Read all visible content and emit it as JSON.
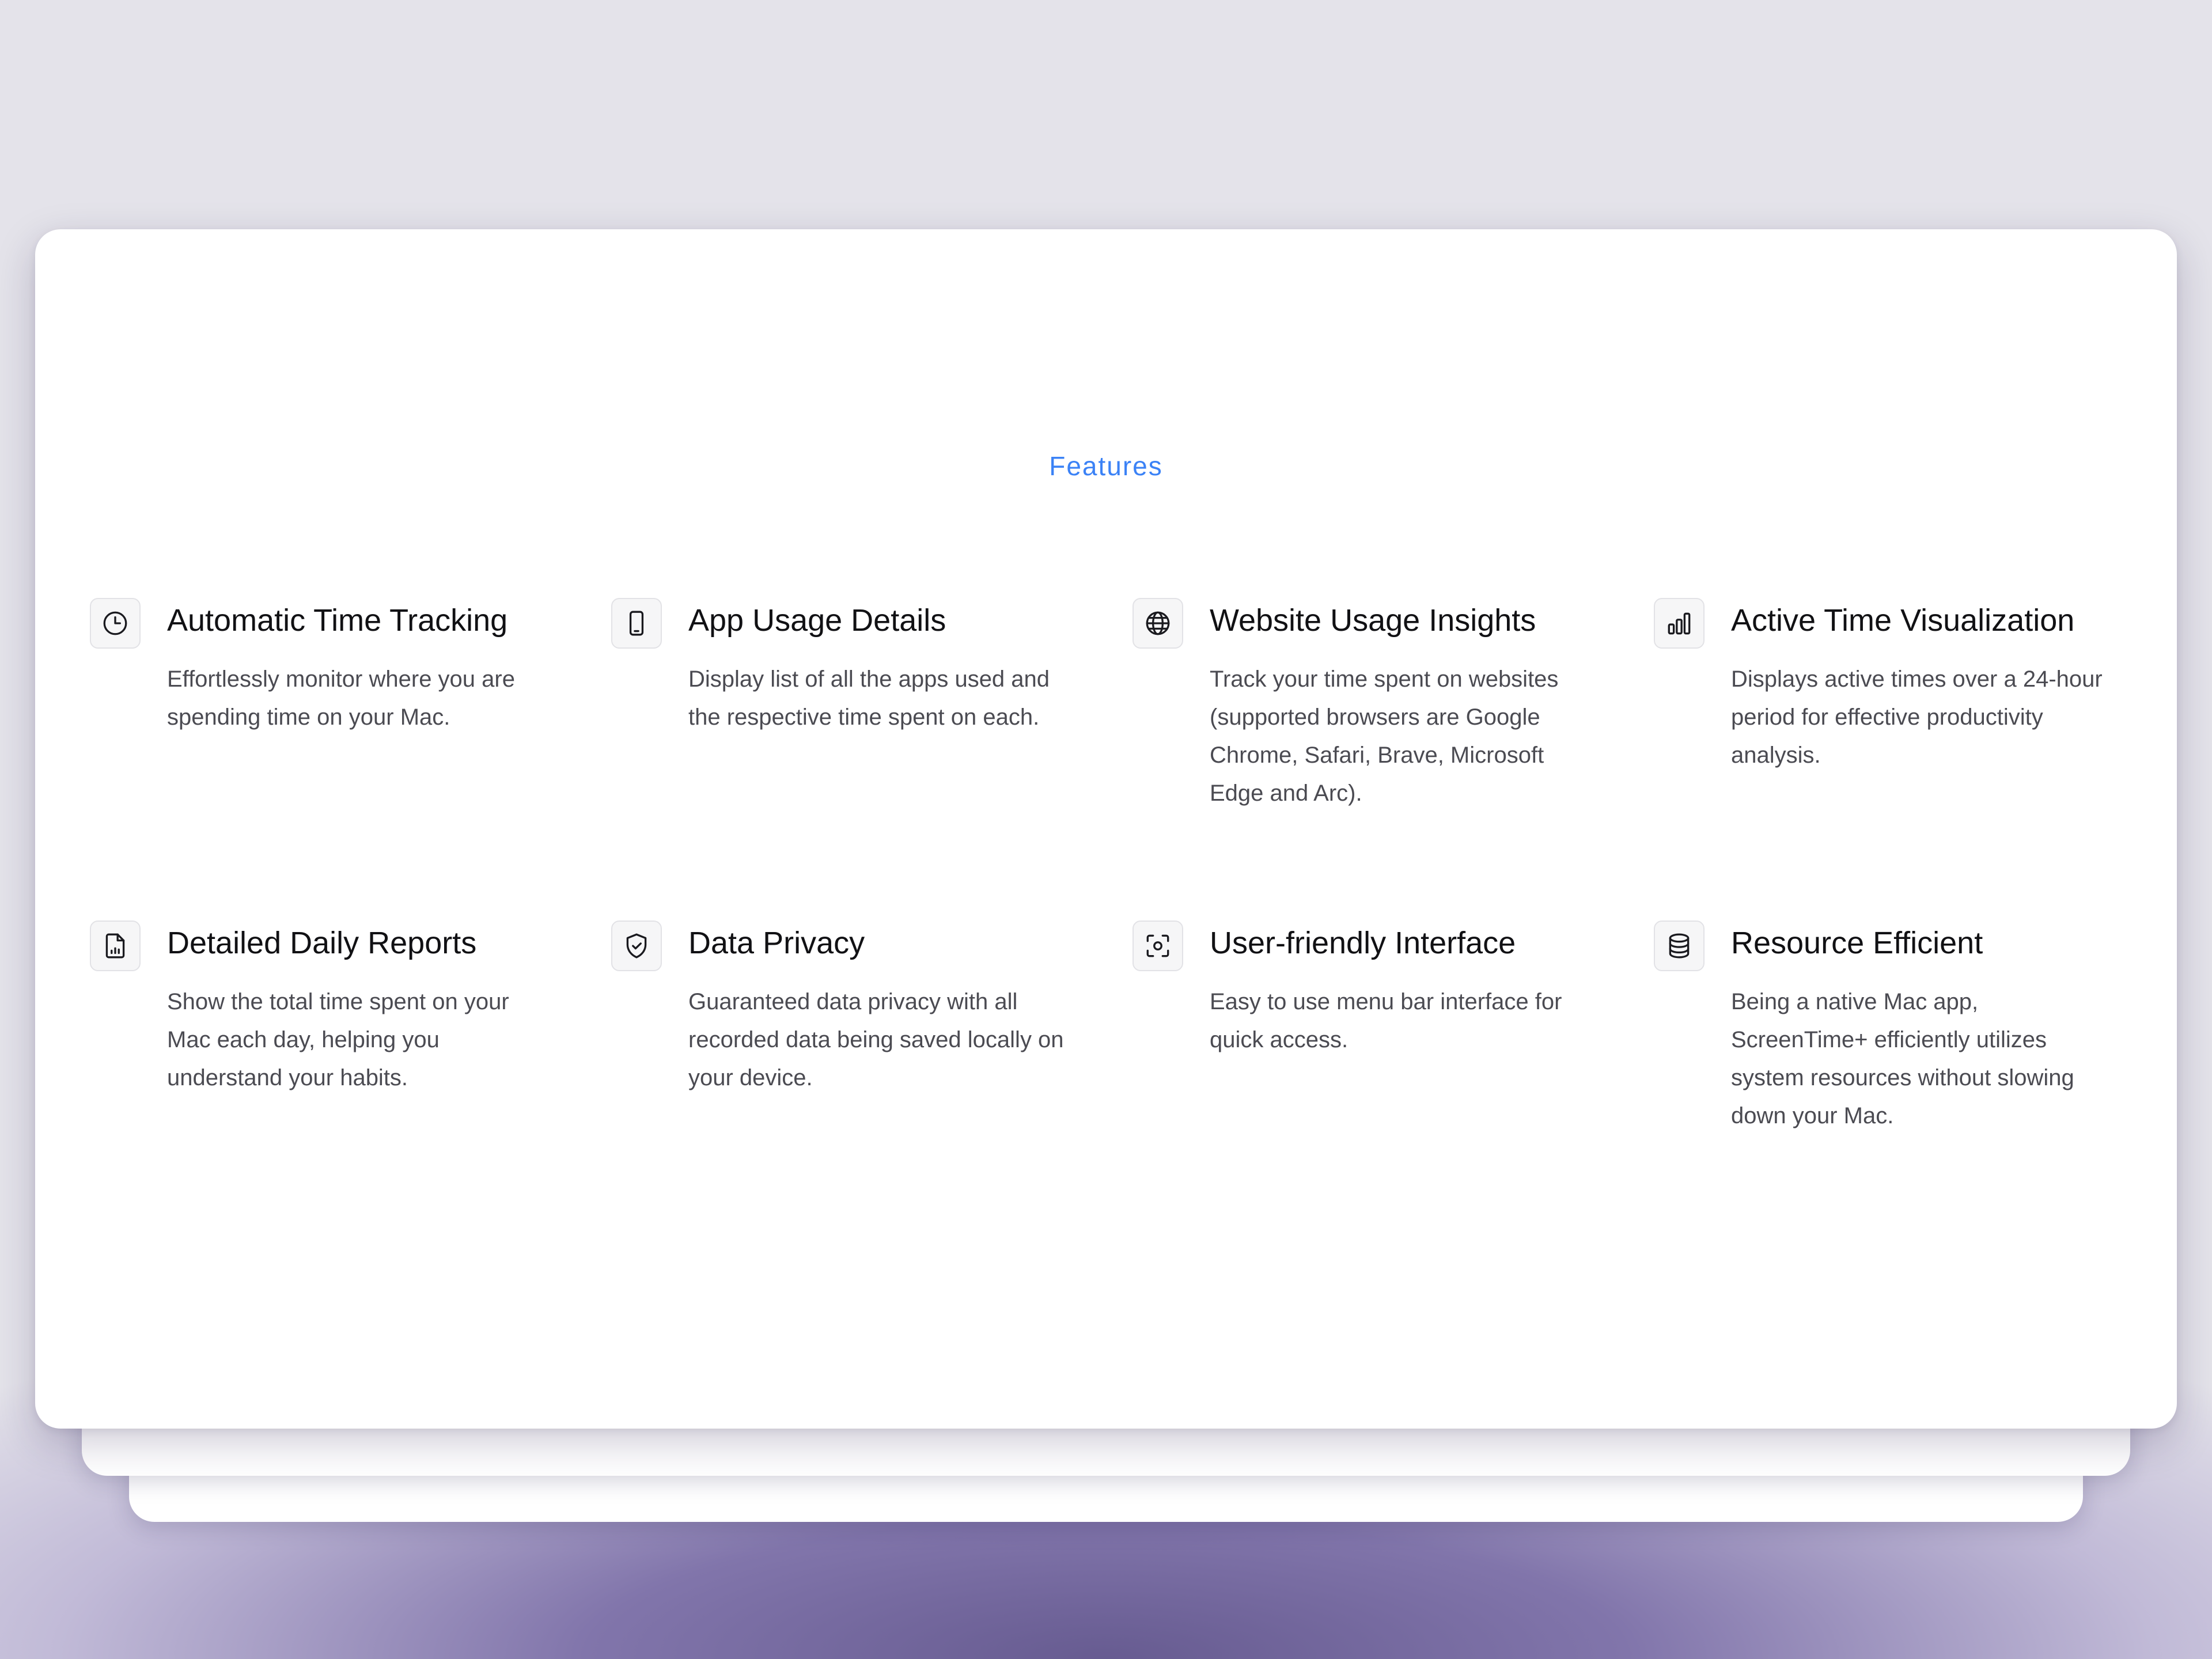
{
  "section": {
    "label": "Features"
  },
  "features": [
    {
      "title": "Automatic Time Tracking",
      "description": "Effortlessly monitor where you are spending time on your Mac.",
      "icon": "clock-icon"
    },
    {
      "title": "App Usage Details",
      "description": "Display list of all the apps used and the respective time spent on each.",
      "icon": "phone-icon"
    },
    {
      "title": "Website Usage Insights",
      "description": "Track your time spent on websites (supported browsers are Google Chrome, Safari, Brave, Microsoft Edge and Arc).",
      "icon": "globe-icon"
    },
    {
      "title": "Active Time Visualization",
      "description": "Displays active times over a 24-hour period for effective productivity analysis.",
      "icon": "bar-chart-icon"
    },
    {
      "title": "Detailed Daily Reports",
      "description": "Show the total time spent on your Mac each day, helping you understand your habits.",
      "icon": "report-icon"
    },
    {
      "title": "Data Privacy",
      "description": "Guaranteed data privacy with all recorded data being saved locally on your device.",
      "icon": "shield-check-icon"
    },
    {
      "title": "User-friendly Interface",
      "description": "Easy to use menu bar interface for quick access.",
      "icon": "focus-icon"
    },
    {
      "title": "Resource Efficient",
      "description": "Being a native Mac app, ScreenTime+ efficiently utilizes system resources without slowing down your Mac.",
      "icon": "database-icon"
    }
  ],
  "colors": {
    "accent": "#3b82f6",
    "background": "#e4e3ea",
    "glow": "#6b5f9a"
  }
}
